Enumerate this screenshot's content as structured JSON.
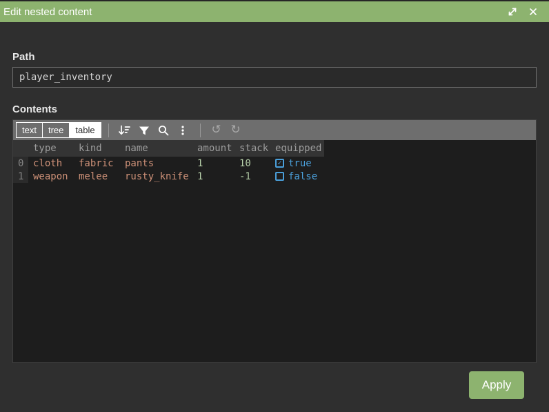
{
  "colors": {
    "accent_green": "#8db36f",
    "toolbar_gray": "#6e6e6e",
    "editor_background": "#1d1d1d",
    "string_value_color": "#ce9178",
    "number_value_color": "#b5cea8",
    "boolean_value_color": "#4a9fda"
  },
  "titlebar": {
    "title": "Edit nested content"
  },
  "path_section": {
    "label": "Path",
    "value": "player_inventory"
  },
  "contents_section": {
    "label": "Contents",
    "toolbar": {
      "mode_buttons": [
        {
          "label": "text",
          "selected": false
        },
        {
          "label": "tree",
          "selected": false
        },
        {
          "label": "table",
          "selected": true
        }
      ]
    },
    "table": {
      "columns": [
        "type",
        "kind",
        "name",
        "amount",
        "stack",
        "equipped"
      ],
      "rows": [
        {
          "index": "0",
          "type": "cloth",
          "kind": "fabric",
          "name": "pants",
          "amount": "1",
          "stack": "10",
          "equipped": true,
          "equipped_label": "true"
        },
        {
          "index": "1",
          "type": "weapon",
          "kind": "melee",
          "name": "rusty_knife",
          "amount": "1",
          "stack": "-1",
          "equipped": false,
          "equipped_label": "false"
        }
      ]
    }
  },
  "footer": {
    "apply_label": "Apply"
  }
}
